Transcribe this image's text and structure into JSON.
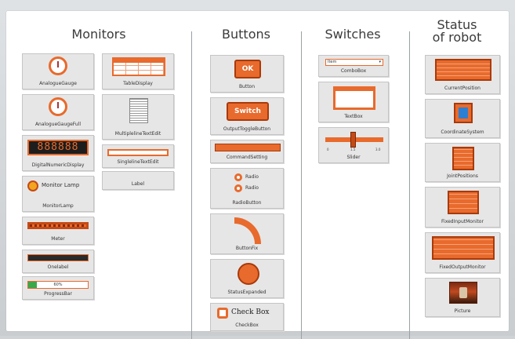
{
  "columns": {
    "monitors": "Monitors",
    "buttons": "Buttons",
    "switches": "Switches",
    "status": "Status\nof robot"
  },
  "monitors": {
    "analogue_gauge": "AnalogueGauge",
    "analogue_gauge_full": "AnalogueGaugeFull",
    "digital_numeric": "DigitalNumericDisplay",
    "digital_digits": "888888",
    "monitor_lamp_text": "Monitor Lamp",
    "monitor_lamp": "MonitorLamp",
    "meter": "Meter",
    "onelabel": "Onelabel",
    "progress_bar": "ProgressBar",
    "progress_text": "60%",
    "table_display": "TableDisplay",
    "multiline_text": "MultiplelineTextEdit",
    "singleline_text": "SinglelineTextEdit",
    "label": "Label"
  },
  "buttons": {
    "ok_text": "OK",
    "button": "Button",
    "switch_text": "Switch",
    "output_toggle": "OutputToggleButton",
    "command_setting": "CommandSetting",
    "radio_1": "Radio",
    "radio_2": "Radio",
    "radio_button": "RadioButton",
    "button_fix": "ButtonFix",
    "status_expanded": "StatusExpanded",
    "check_box_text": "Check Box",
    "check_box": "CheckBox"
  },
  "switches": {
    "combo_value": "Item",
    "combo_box": "ComboBox",
    "text_box": "TextBox",
    "slider": "Slider",
    "slider_ticks": [
      "0",
      "1.5",
      "3.0"
    ]
  },
  "status": {
    "current_position": "CurrentPosition",
    "coordinate_system": "CoordinateSystem",
    "joint_positions": "JointPositions",
    "fixed_input_monitor": "FixedInputMonitor",
    "fixed_output_monitor": "FixedOutputMonitor",
    "picture": "Picture"
  },
  "colors": {
    "accent": "#e86a2c",
    "accent_dark": "#c54a15",
    "tile": "#e6e6e6"
  }
}
